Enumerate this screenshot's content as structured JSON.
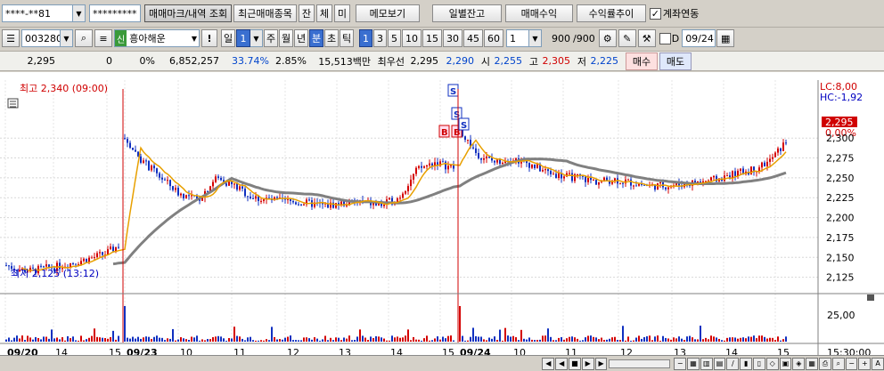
{
  "toolbar": {
    "account": "****-**81",
    "password": "*********",
    "tab_trade_marks": "매매마크/내역 조회",
    "btn_recent": "최근매매종목",
    "btn_balance": "잔",
    "btn_fill": "체",
    "btn_unfilled": "미",
    "btn_memo": "메모보기",
    "btn_daily_balance": "일별잔고",
    "btn_trade_profit": "매매수익",
    "btn_return_trend": "수익률추이",
    "link_account_label": "계좌연동",
    "link_account_checked": true
  },
  "toolbar2": {
    "stock_code": "003280",
    "credit_mark": "신",
    "stock_name": "흥아해운",
    "excl": "!",
    "periods": [
      "일",
      "주",
      "월",
      "년",
      "분",
      "초",
      "틱"
    ],
    "period_active": "분",
    "day_num": "1",
    "intervals": [
      "1",
      "3",
      "5",
      "10",
      "15",
      "30",
      "45",
      "60"
    ],
    "interval_active": "1",
    "count": "1",
    "data_count": "900",
    "data_total": "/900",
    "date_checkbox_label": "D",
    "date_value": "09/24"
  },
  "quote": {
    "price": "2,295",
    "change": "0",
    "change_pct": "0%",
    "volume": "6,852,257",
    "vol_ratio": "33.74%",
    "turnover": "2.85%",
    "amount": "15,513백만",
    "best_ask_label": "최우선",
    "best_ask": "2,295",
    "best_bid": "2,290",
    "open_label": "시",
    "open": "2,255",
    "high_label": "고",
    "high": "2,305",
    "low_label": "저",
    "low": "2,225",
    "buy_label": "매수",
    "sell_label": "매도"
  },
  "chart_labels": {
    "high_marker": "최고 2,340 (09:00)",
    "low_marker": "최저 2,125 (13:12)",
    "lc": "LC:8,00",
    "hc": "HC:-1,92",
    "current_price": "2,295",
    "current_pct": "0,00%",
    "y_ticks": [
      "2,300",
      "2,275",
      "2,250",
      "2,225",
      "2,200",
      "2,175",
      "2,150",
      "2,125"
    ],
    "vol_tick": "25,00",
    "x_labels": [
      "09/20",
      "14",
      "15",
      "09/23",
      "10",
      "11",
      "12",
      "13",
      "14",
      "15",
      "09/24",
      "10",
      "11",
      "12",
      "13",
      "14",
      "15"
    ],
    "time_label": "15:30:00"
  },
  "colors": {
    "up": "#d40000",
    "down": "#1030c0",
    "ma_short": "#e8a000",
    "ma_long": "#808080",
    "active": "#3a6fd0"
  },
  "chart_data": {
    "type": "candlestick",
    "ylim": [
      2110,
      2345
    ],
    "sessions": [
      {
        "date": "09/20",
        "close_trend": [
          2140,
          2135,
          2133,
          2136,
          2138,
          2142,
          2146,
          2150,
          2155,
          2165
        ]
      },
      {
        "date": "09/23",
        "close_trend": [
          2300,
          2270,
          2250,
          2230,
          2222,
          2250,
          2240,
          2225,
          2222,
          2220,
          2218,
          2215,
          2218,
          2220,
          2215,
          2225,
          2260,
          2270,
          2262
        ]
      },
      {
        "date": "09/24",
        "close_trend": [
          2310,
          2280,
          2270,
          2275,
          2268,
          2258,
          2252,
          2250,
          2245,
          2248,
          2244,
          2240,
          2240,
          2242,
          2245,
          2248,
          2255,
          2260,
          2270,
          2295
        ]
      }
    ],
    "annotations": [
      "S",
      "S",
      "B",
      "B",
      "S"
    ]
  }
}
